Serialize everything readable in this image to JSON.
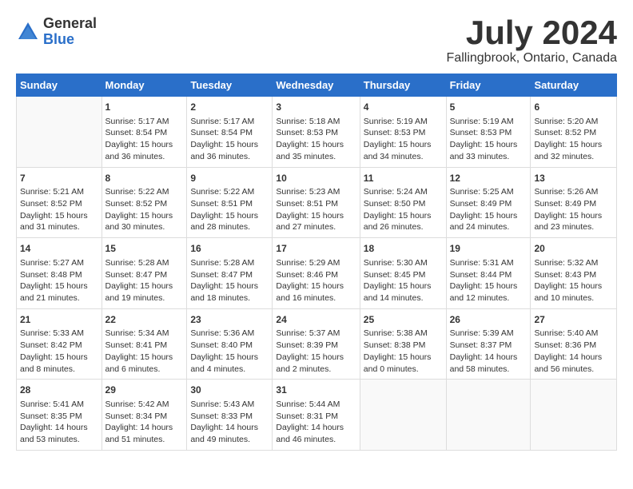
{
  "logo": {
    "general": "General",
    "blue": "Blue"
  },
  "title": "July 2024",
  "location": "Fallingbrook, Ontario, Canada",
  "days": [
    "Sunday",
    "Monday",
    "Tuesday",
    "Wednesday",
    "Thursday",
    "Friday",
    "Saturday"
  ],
  "weeks": [
    [
      {
        "date": "",
        "sunrise": "",
        "sunset": "",
        "daylight": ""
      },
      {
        "date": "1",
        "sunrise": "Sunrise: 5:17 AM",
        "sunset": "Sunset: 8:54 PM",
        "daylight": "Daylight: 15 hours and 36 minutes."
      },
      {
        "date": "2",
        "sunrise": "Sunrise: 5:17 AM",
        "sunset": "Sunset: 8:54 PM",
        "daylight": "Daylight: 15 hours and 36 minutes."
      },
      {
        "date": "3",
        "sunrise": "Sunrise: 5:18 AM",
        "sunset": "Sunset: 8:53 PM",
        "daylight": "Daylight: 15 hours and 35 minutes."
      },
      {
        "date": "4",
        "sunrise": "Sunrise: 5:19 AM",
        "sunset": "Sunset: 8:53 PM",
        "daylight": "Daylight: 15 hours and 34 minutes."
      },
      {
        "date": "5",
        "sunrise": "Sunrise: 5:19 AM",
        "sunset": "Sunset: 8:53 PM",
        "daylight": "Daylight: 15 hours and 33 minutes."
      },
      {
        "date": "6",
        "sunrise": "Sunrise: 5:20 AM",
        "sunset": "Sunset: 8:52 PM",
        "daylight": "Daylight: 15 hours and 32 minutes."
      }
    ],
    [
      {
        "date": "7",
        "sunrise": "Sunrise: 5:21 AM",
        "sunset": "Sunset: 8:52 PM",
        "daylight": "Daylight: 15 hours and 31 minutes."
      },
      {
        "date": "8",
        "sunrise": "Sunrise: 5:22 AM",
        "sunset": "Sunset: 8:52 PM",
        "daylight": "Daylight: 15 hours and 30 minutes."
      },
      {
        "date": "9",
        "sunrise": "Sunrise: 5:22 AM",
        "sunset": "Sunset: 8:51 PM",
        "daylight": "Daylight: 15 hours and 28 minutes."
      },
      {
        "date": "10",
        "sunrise": "Sunrise: 5:23 AM",
        "sunset": "Sunset: 8:51 PM",
        "daylight": "Daylight: 15 hours and 27 minutes."
      },
      {
        "date": "11",
        "sunrise": "Sunrise: 5:24 AM",
        "sunset": "Sunset: 8:50 PM",
        "daylight": "Daylight: 15 hours and 26 minutes."
      },
      {
        "date": "12",
        "sunrise": "Sunrise: 5:25 AM",
        "sunset": "Sunset: 8:49 PM",
        "daylight": "Daylight: 15 hours and 24 minutes."
      },
      {
        "date": "13",
        "sunrise": "Sunrise: 5:26 AM",
        "sunset": "Sunset: 8:49 PM",
        "daylight": "Daylight: 15 hours and 23 minutes."
      }
    ],
    [
      {
        "date": "14",
        "sunrise": "Sunrise: 5:27 AM",
        "sunset": "Sunset: 8:48 PM",
        "daylight": "Daylight: 15 hours and 21 minutes."
      },
      {
        "date": "15",
        "sunrise": "Sunrise: 5:28 AM",
        "sunset": "Sunset: 8:47 PM",
        "daylight": "Daylight: 15 hours and 19 minutes."
      },
      {
        "date": "16",
        "sunrise": "Sunrise: 5:28 AM",
        "sunset": "Sunset: 8:47 PM",
        "daylight": "Daylight: 15 hours and 18 minutes."
      },
      {
        "date": "17",
        "sunrise": "Sunrise: 5:29 AM",
        "sunset": "Sunset: 8:46 PM",
        "daylight": "Daylight: 15 hours and 16 minutes."
      },
      {
        "date": "18",
        "sunrise": "Sunrise: 5:30 AM",
        "sunset": "Sunset: 8:45 PM",
        "daylight": "Daylight: 15 hours and 14 minutes."
      },
      {
        "date": "19",
        "sunrise": "Sunrise: 5:31 AM",
        "sunset": "Sunset: 8:44 PM",
        "daylight": "Daylight: 15 hours and 12 minutes."
      },
      {
        "date": "20",
        "sunrise": "Sunrise: 5:32 AM",
        "sunset": "Sunset: 8:43 PM",
        "daylight": "Daylight: 15 hours and 10 minutes."
      }
    ],
    [
      {
        "date": "21",
        "sunrise": "Sunrise: 5:33 AM",
        "sunset": "Sunset: 8:42 PM",
        "daylight": "Daylight: 15 hours and 8 minutes."
      },
      {
        "date": "22",
        "sunrise": "Sunrise: 5:34 AM",
        "sunset": "Sunset: 8:41 PM",
        "daylight": "Daylight: 15 hours and 6 minutes."
      },
      {
        "date": "23",
        "sunrise": "Sunrise: 5:36 AM",
        "sunset": "Sunset: 8:40 PM",
        "daylight": "Daylight: 15 hours and 4 minutes."
      },
      {
        "date": "24",
        "sunrise": "Sunrise: 5:37 AM",
        "sunset": "Sunset: 8:39 PM",
        "daylight": "Daylight: 15 hours and 2 minutes."
      },
      {
        "date": "25",
        "sunrise": "Sunrise: 5:38 AM",
        "sunset": "Sunset: 8:38 PM",
        "daylight": "Daylight: 15 hours and 0 minutes."
      },
      {
        "date": "26",
        "sunrise": "Sunrise: 5:39 AM",
        "sunset": "Sunset: 8:37 PM",
        "daylight": "Daylight: 14 hours and 58 minutes."
      },
      {
        "date": "27",
        "sunrise": "Sunrise: 5:40 AM",
        "sunset": "Sunset: 8:36 PM",
        "daylight": "Daylight: 14 hours and 56 minutes."
      }
    ],
    [
      {
        "date": "28",
        "sunrise": "Sunrise: 5:41 AM",
        "sunset": "Sunset: 8:35 PM",
        "daylight": "Daylight: 14 hours and 53 minutes."
      },
      {
        "date": "29",
        "sunrise": "Sunrise: 5:42 AM",
        "sunset": "Sunset: 8:34 PM",
        "daylight": "Daylight: 14 hours and 51 minutes."
      },
      {
        "date": "30",
        "sunrise": "Sunrise: 5:43 AM",
        "sunset": "Sunset: 8:33 PM",
        "daylight": "Daylight: 14 hours and 49 minutes."
      },
      {
        "date": "31",
        "sunrise": "Sunrise: 5:44 AM",
        "sunset": "Sunset: 8:31 PM",
        "daylight": "Daylight: 14 hours and 46 minutes."
      },
      {
        "date": "",
        "sunrise": "",
        "sunset": "",
        "daylight": ""
      },
      {
        "date": "",
        "sunrise": "",
        "sunset": "",
        "daylight": ""
      },
      {
        "date": "",
        "sunrise": "",
        "sunset": "",
        "daylight": ""
      }
    ]
  ]
}
